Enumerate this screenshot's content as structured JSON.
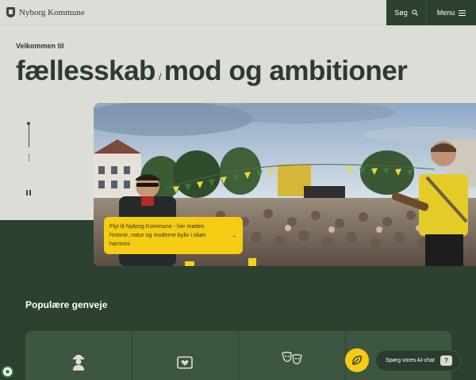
{
  "header": {
    "logo_text": "Nyborg Kommune",
    "search_label": "Søg",
    "menu_label": "Menu"
  },
  "hero": {
    "welcome": "Velkommen til",
    "headline_part1": "fællesskab",
    "headline_sep": "/",
    "headline_part2": "mod og ambitioner",
    "callout_text": "Flyt til Nyborg Kommune - her mødes historie, natur og moderne byliv i skøn harmoni",
    "callout_arrow": "→"
  },
  "shortcuts": {
    "title": "Populære genveje",
    "cards": [
      {
        "icon": "worker-icon"
      },
      {
        "icon": "heart-frame-icon"
      },
      {
        "icon": "theater-masks-icon"
      },
      {
        "icon": "blank"
      }
    ]
  },
  "chat": {
    "label": "Spørg vores AI-chat",
    "bubble": "?"
  },
  "colors": {
    "dark_green": "#2d4130",
    "beige": "#dcddd6",
    "yellow": "#f6cb13"
  }
}
